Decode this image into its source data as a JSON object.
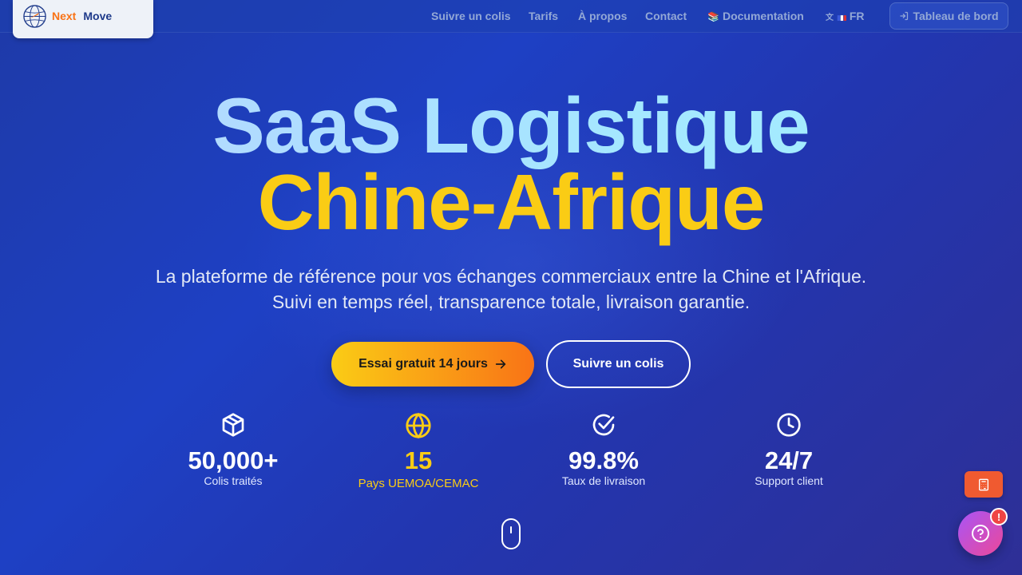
{
  "brand": {
    "name_part1": "Next",
    "name_part2": "Move",
    "logo_icon": "globe-plane-icon"
  },
  "nav": {
    "links": [
      {
        "label": "Suivre un colis"
      },
      {
        "label": "Tarifs"
      },
      {
        "label": "À propos"
      },
      {
        "label": "Contact"
      },
      {
        "label": "Documentation",
        "icon": "books-icon"
      },
      {
        "label": "FR",
        "icon": "translate-icon",
        "flag": "france-flag-icon"
      }
    ],
    "dashboard_label": "Tableau de bord",
    "dashboard_icon": "login-icon"
  },
  "hero": {
    "title_line1": "SaaS Logistique",
    "title_line2": "Chine-Afrique",
    "subtitle": "La plateforme de référence pour vos échanges commerciaux entre la Chine et l'Afrique. Suivi en temps réel, transparence totale, livraison garantie.",
    "cta_primary": "Essai gratuit 14 jours",
    "cta_secondary": "Suivre un colis"
  },
  "stats": [
    {
      "value": "50,000+",
      "label": "Colis traités",
      "icon": "package-icon"
    },
    {
      "value": "15",
      "label": "Pays UEMOA/CEMAC",
      "icon": "globe-icon"
    },
    {
      "value": "99.8%",
      "label": "Taux de livraison",
      "icon": "check-circle-icon"
    },
    {
      "value": "24/7",
      "label": "Support client",
      "icon": "clock-icon"
    }
  ],
  "floating": {
    "help_badge": "!",
    "calculator_icon": "calculator-icon",
    "help_icon": "help-circle-icon"
  },
  "colors": {
    "accent_yellow": "#facc15",
    "accent_orange": "#f97316",
    "bg_blue": "#1e40af",
    "help_purple": "#a855f7",
    "help_pink": "#ec4899"
  }
}
